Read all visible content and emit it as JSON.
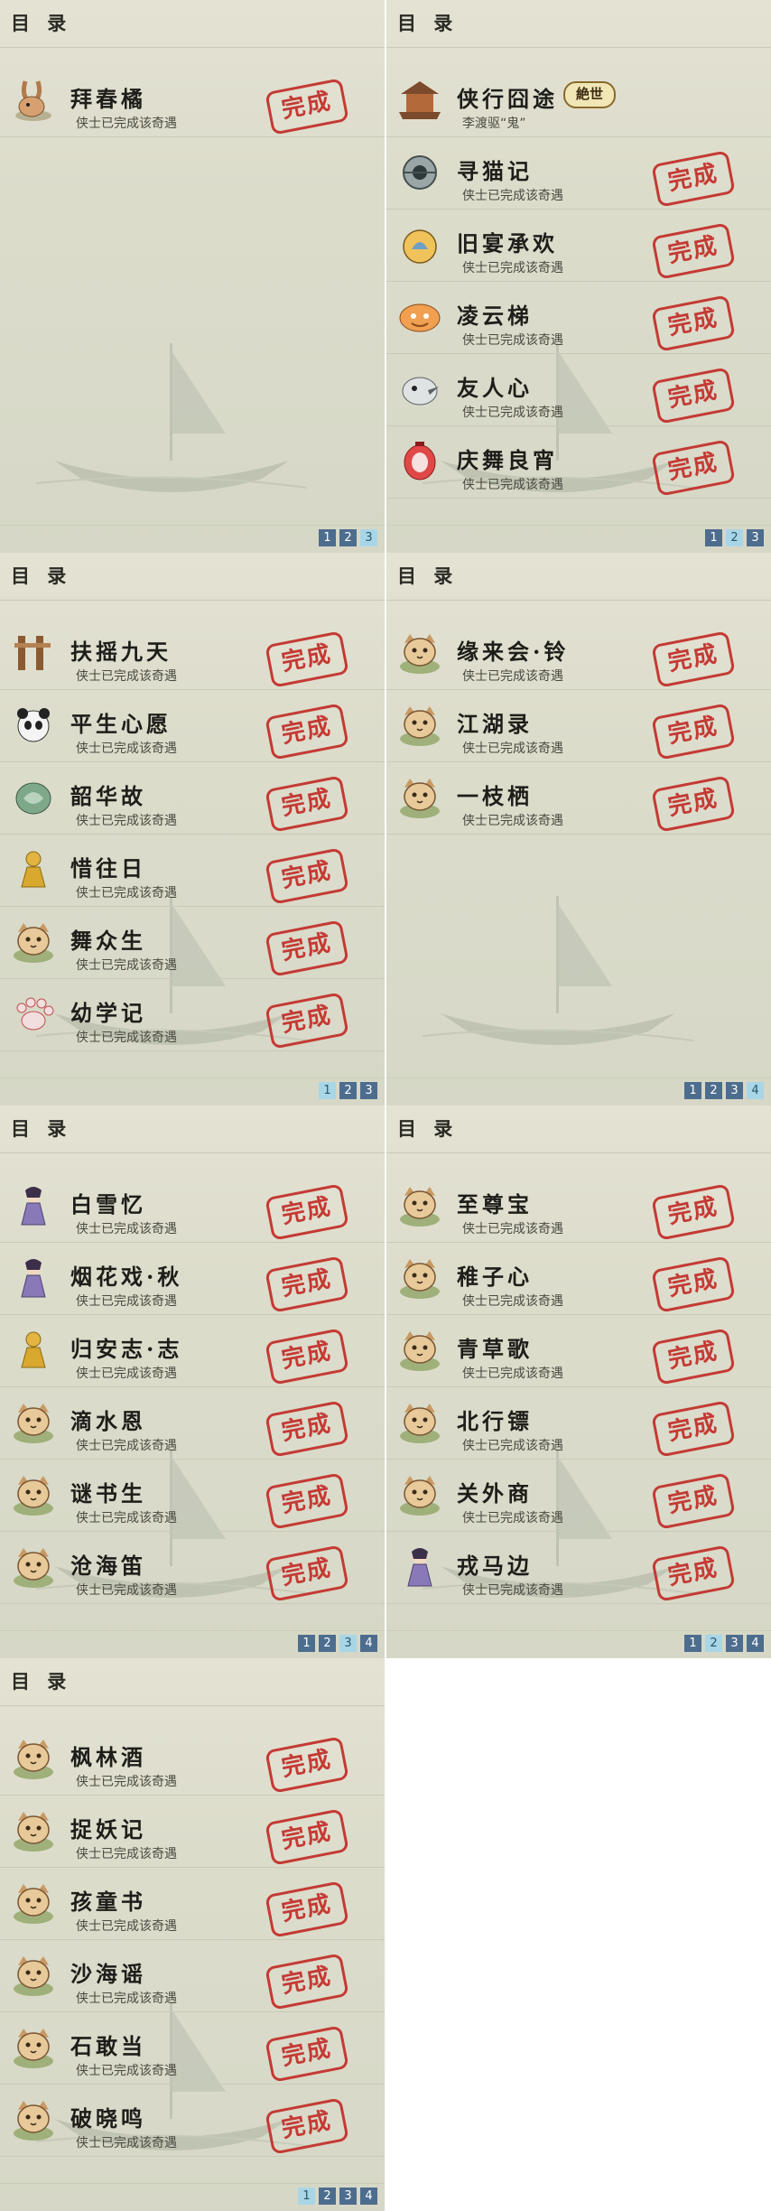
{
  "colors": {
    "stamp": "#c43a34",
    "pager": "#4d6d8e",
    "pager_active": "#a9d6e6"
  },
  "panels": [
    {
      "title": "目 录",
      "rows": [
        {
          "name": "拜春橘",
          "desc": "侠士已完成该奇遇",
          "stamp": "完成",
          "icon": "rabbit-icon"
        }
      ],
      "pages": [
        "1",
        "2",
        "3"
      ],
      "active_page": 3
    },
    {
      "title": "目 录",
      "rows": [
        {
          "name": "侠行囧途",
          "desc": "李渡驱“鬼”",
          "badge": "絶世",
          "icon": "pavilion-icon"
        },
        {
          "name": "寻猫记",
          "desc": "侠士已完成该奇遇",
          "stamp": "完成",
          "icon": "orb-icon"
        },
        {
          "name": "旧宴承欢",
          "desc": "侠士已完成该奇遇",
          "stamp": "完成",
          "icon": "gourd-icon"
        },
        {
          "name": "凌云梯",
          "desc": "侠士已完成该奇遇",
          "stamp": "完成",
          "icon": "lion-icon"
        },
        {
          "name": "友人心",
          "desc": "侠士已完成该奇遇",
          "stamp": "完成",
          "icon": "bird-icon"
        },
        {
          "name": "庆舞良宵",
          "desc": "侠士已完成该奇遇",
          "stamp": "完成",
          "icon": "lantern-icon"
        }
      ],
      "pages": [
        "1",
        "2",
        "3"
      ],
      "active_page": 2
    },
    {
      "title": "目 录",
      "rows": [
        {
          "name": "扶摇九天",
          "desc": "侠士已完成该奇遇",
          "stamp": "完成",
          "icon": "pillar-icon"
        },
        {
          "name": "平生心愿",
          "desc": "侠士已完成该奇遇",
          "stamp": "完成",
          "icon": "panda-icon"
        },
        {
          "name": "韶华故",
          "desc": "侠士已完成该奇遇",
          "stamp": "完成",
          "icon": "jade-icon"
        },
        {
          "name": "惜往日",
          "desc": "侠士已完成该奇遇",
          "stamp": "完成",
          "icon": "golden-figure-icon"
        },
        {
          "name": "舞众生",
          "desc": "侠士已完成该奇遇",
          "stamp": "完成",
          "icon": "cat-icon"
        },
        {
          "name": "幼学记",
          "desc": "侠士已完成该奇遇",
          "stamp": "完成",
          "icon": "paw-icon"
        }
      ],
      "pages": [
        "1",
        "2",
        "3"
      ],
      "active_page": 1
    },
    {
      "title": "目 录",
      "rows": [
        {
          "name": "缘来会·铃",
          "desc": "侠士已完成该奇遇",
          "stamp": "完成",
          "icon": "cat-icon"
        },
        {
          "name": "江湖录",
          "desc": "侠士已完成该奇遇",
          "stamp": "完成",
          "icon": "cat-icon"
        },
        {
          "name": "一枝栖",
          "desc": "侠士已完成该奇遇",
          "stamp": "完成",
          "icon": "cat-icon"
        }
      ],
      "pages": [
        "1",
        "2",
        "3",
        "4"
      ],
      "active_page": 4
    },
    {
      "title": "目 录",
      "rows": [
        {
          "name": "白雪忆",
          "desc": "侠士已完成该奇遇",
          "stamp": "完成",
          "icon": "lady-icon"
        },
        {
          "name": "烟花戏·秋",
          "desc": "侠士已完成该奇遇",
          "stamp": "完成",
          "icon": "lady-icon"
        },
        {
          "name": "归安志·志",
          "desc": "侠士已完成该奇遇",
          "stamp": "完成",
          "icon": "golden-figure-icon"
        },
        {
          "name": "滴水恩",
          "desc": "侠士已完成该奇遇",
          "stamp": "完成",
          "icon": "cat-icon"
        },
        {
          "name": "谜书生",
          "desc": "侠士已完成该奇遇",
          "stamp": "完成",
          "icon": "cat-icon"
        },
        {
          "name": "沧海笛",
          "desc": "侠士已完成该奇遇",
          "stamp": "完成",
          "icon": "cat-icon"
        }
      ],
      "pages": [
        "1",
        "2",
        "3",
        "4"
      ],
      "active_page": 3
    },
    {
      "title": "目 录",
      "rows": [
        {
          "name": "至尊宝",
          "desc": "侠士已完成该奇遇",
          "stamp": "完成",
          "icon": "cat-icon"
        },
        {
          "name": "稚子心",
          "desc": "侠士已完成该奇遇",
          "stamp": "完成",
          "icon": "cat-icon"
        },
        {
          "name": "青草歌",
          "desc": "侠士已完成该奇遇",
          "stamp": "完成",
          "icon": "cat-icon"
        },
        {
          "name": "北行镖",
          "desc": "侠士已完成该奇遇",
          "stamp": "完成",
          "icon": "cat-icon"
        },
        {
          "name": "关外商",
          "desc": "侠士已完成该奇遇",
          "stamp": "完成",
          "icon": "cat-icon"
        },
        {
          "name": "戎马边",
          "desc": "侠士已完成该奇遇",
          "stamp": "完成",
          "icon": "lady-icon"
        }
      ],
      "pages": [
        "1",
        "2",
        "3",
        "4"
      ],
      "active_page": 2
    },
    {
      "title": "目 录",
      "rows": [
        {
          "name": "枫林酒",
          "desc": "侠士已完成该奇遇",
          "stamp": "完成",
          "icon": "cat-icon"
        },
        {
          "name": "捉妖记",
          "desc": "侠士已完成该奇遇",
          "stamp": "完成",
          "icon": "cat-icon"
        },
        {
          "name": "孩童书",
          "desc": "侠士已完成该奇遇",
          "stamp": "完成",
          "icon": "cat-icon"
        },
        {
          "name": "沙海谣",
          "desc": "侠士已完成该奇遇",
          "stamp": "完成",
          "icon": "cat-icon"
        },
        {
          "name": "石敢当",
          "desc": "侠士已完成该奇遇",
          "stamp": "完成",
          "icon": "cat-icon"
        },
        {
          "name": "破晓鸣",
          "desc": "侠士已完成该奇遇",
          "stamp": "完成",
          "icon": "cat-icon"
        }
      ],
      "pages": [
        "1",
        "2",
        "3",
        "4"
      ],
      "active_page": 1
    }
  ]
}
